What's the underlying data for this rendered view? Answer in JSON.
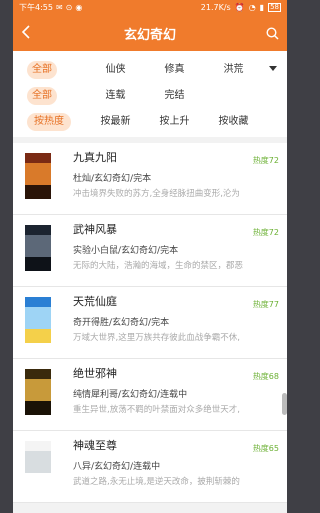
{
  "status": {
    "time": "下午4:55",
    "speed": "21.7K/s",
    "battery": "58"
  },
  "header": {
    "title": "玄幻奇幻"
  },
  "filters": {
    "row1": [
      "全部",
      "仙侠",
      "修真",
      "洪荒"
    ],
    "row2": [
      "全部",
      "连载",
      "完结"
    ],
    "row3": [
      "按热度",
      "按最新",
      "按上升",
      "按收藏"
    ]
  },
  "books": [
    {
      "title": "九真九阳",
      "meta": "杜灿/玄幻奇幻/完本",
      "desc": "冲击境界失败的苏方,全身经脉扭曲变形,沦为",
      "heat": "热度72",
      "cover_colors": [
        "#7a2a14",
        "#d97a2a",
        "#2a1408"
      ]
    },
    {
      "title": "武神风暴",
      "meta": "实验小白鼠/玄幻奇幻/完本",
      "desc": "无际的大陆，浩瀚的海域，生命的禁区，郡恶",
      "heat": "热度72",
      "cover_colors": [
        "#1c2430",
        "#5c6878",
        "#0e1218"
      ]
    },
    {
      "title": "天荒仙庭",
      "meta": "奇开得胜/玄幻奇幻/完本",
      "desc": "万域大世界,这里万族共存彼此血战争霸不休,",
      "heat": "热度77",
      "cover_colors": [
        "#2a7fd4",
        "#9ed4f5",
        "#f4d04a"
      ]
    },
    {
      "title": "绝世邪神",
      "meta": "纯情犀利哥/玄幻奇幻/连载中",
      "desc": "重生异世,放荡不羁的叶禁面对众多绝世天才,",
      "heat": "热度68",
      "cover_colors": [
        "#3a2a0c",
        "#c89a3a",
        "#1a1206"
      ]
    },
    {
      "title": "神魂至尊",
      "meta": "八异/玄幻奇幻/连载中",
      "desc": "武道之路,永无止境,是逆天改命，披荆斩棘的",
      "heat": "热度65",
      "cover_colors": [
        "#f4f4f4",
        "#d8dde0",
        "#ffffff"
      ]
    }
  ]
}
